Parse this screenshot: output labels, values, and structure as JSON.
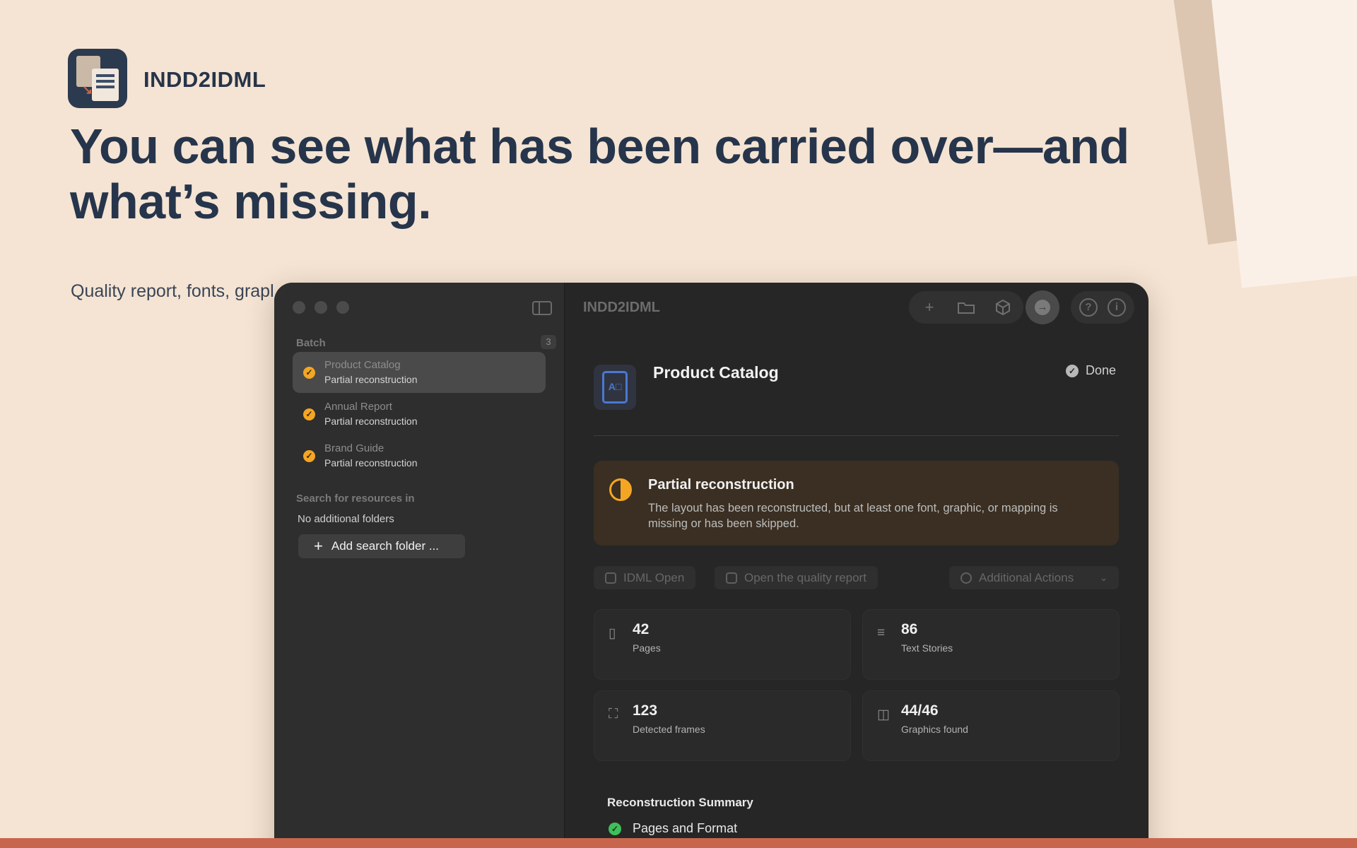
{
  "brand": {
    "app_name": "INDD2IDML"
  },
  "headline": "You can see what has been carried over—and what’s missing.",
  "subtitle": "Quality report, fonts, grapl",
  "window": {
    "title": "INDD2IDML",
    "sidebar": {
      "batch_label": "Batch",
      "batch_count": "3",
      "items": [
        {
          "name": "Product Catalog",
          "status": "Partial reconstruction"
        },
        {
          "name": "Annual Report",
          "status": "Partial reconstruction"
        },
        {
          "name": "Brand Guide",
          "status": "Partial reconstruction"
        }
      ],
      "search_label": "Search for resources in",
      "no_folders": "No additional folders",
      "add_folder_label": "Add search folder ..."
    },
    "document": {
      "title": "Product Catalog",
      "done_label": "Done",
      "warning_title": "Partial reconstruction",
      "warning_text": "The layout has been reconstructed, but at least one font, graphic, or mapping is missing or has been skipped."
    },
    "actions": {
      "idml_open": "IDML Open",
      "quality_report": "Open the quality report",
      "additional": "Additional Actions"
    },
    "stats": [
      {
        "value": "42",
        "label": "Pages",
        "icon": "page-icon"
      },
      {
        "value": "86",
        "label": "Text Stories",
        "icon": "text-lines-icon"
      },
      {
        "value": "123",
        "label": "Detected frames",
        "icon": "frame-icon"
      },
      {
        "value": "44/46",
        "label": "Graphics found",
        "icon": "images-icon"
      }
    ],
    "summary": {
      "title": "Reconstruction Summary",
      "rows": [
        {
          "label": "Pages and Format"
        }
      ]
    }
  },
  "colors": {
    "background": "#f5e4d3",
    "accent_warning": "#f4a623",
    "accent_success": "#3fbf5a",
    "brand_dark": "#26354b",
    "bottom_bar": "#c8664d"
  }
}
